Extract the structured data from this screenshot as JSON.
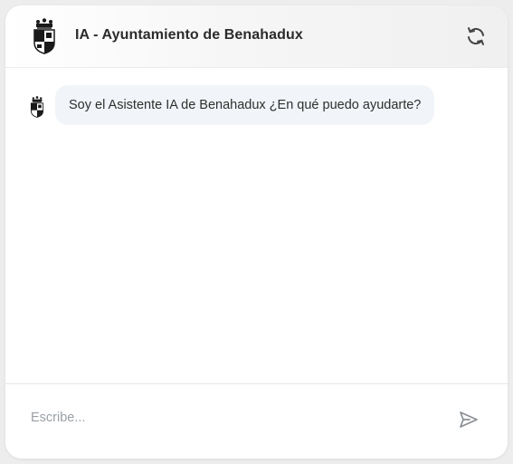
{
  "header": {
    "title": "IA - Ayuntamiento de Benahadux",
    "logo_icon": "benahadux-coat-of-arms-icon",
    "refresh_icon": "refresh-icon"
  },
  "messages": [
    {
      "sender": "bot",
      "avatar_icon": "benahadux-coat-of-arms-icon",
      "text": "Soy el Asistente IA de Benahadux ¿En qué puedo ayudarte?"
    }
  ],
  "composer": {
    "placeholder": "Escribe...",
    "value": "",
    "send_icon": "send-icon"
  },
  "colors": {
    "bubble_background": "#f1f4f8",
    "title_text": "#2b2b2b",
    "icon": "#555555"
  }
}
